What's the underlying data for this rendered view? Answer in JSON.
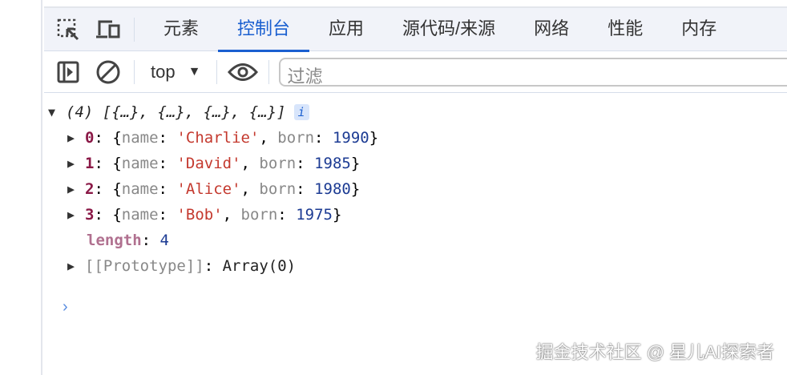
{
  "tabs": [
    "元素",
    "控制台",
    "应用",
    "源代码/来源",
    "网络",
    "性能",
    "内存"
  ],
  "active_tab": "控制台",
  "toolbar": {
    "context": "top",
    "filter_placeholder": "过滤"
  },
  "console": {
    "summary": "(4) [{…}, {…}, {…}, {…}]",
    "info_badge": "i",
    "items": [
      {
        "index": "0",
        "name": "'Charlie'",
        "born": "1990"
      },
      {
        "index": "1",
        "name": "'David'",
        "born": "1985"
      },
      {
        "index": "2",
        "name": "'Alice'",
        "born": "1980"
      },
      {
        "index": "3",
        "name": "'Bob'",
        "born": "1975"
      }
    ],
    "name_key": "name",
    "born_key": "born",
    "length_key": "length",
    "length_value": "4",
    "prototype_key": "[[Prototype]]",
    "prototype_value": "Array(0)",
    "prompt": "›"
  },
  "watermark": "掘金技术社区 @ 星儿AI探索者"
}
